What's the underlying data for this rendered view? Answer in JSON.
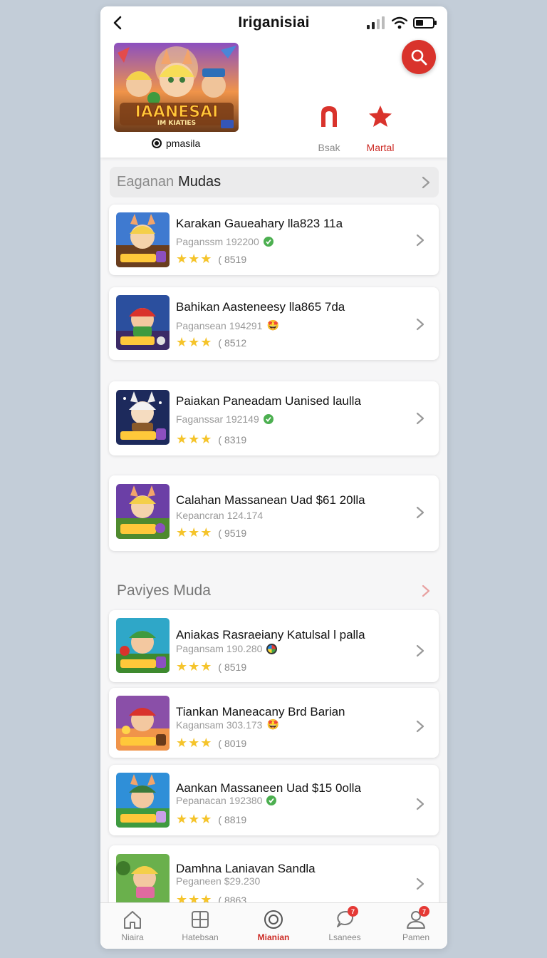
{
  "header": {
    "title": "Iriganisiai",
    "banner_text": "IAANESAI",
    "banner_subtext": "IM KIATIES",
    "brand_label": "pmasila",
    "actions": [
      {
        "label": "Bsak",
        "icon": "bookmark-icon"
      },
      {
        "label": "Martal",
        "icon": "star-icon"
      }
    ]
  },
  "sections": [
    {
      "title_muted": "Eaganan",
      "title_strong": "Mudas",
      "items": [
        {
          "title": "Karakan Gaueahary lla823 11a",
          "sub": "Paganssm 192200",
          "badge": "check",
          "rating_text": "( 8519",
          "stars": "★★★"
        },
        {
          "title": "Bahikan Aasteneesy lla865 7da",
          "sub": "Pagansean 194291",
          "badge": "emoji",
          "rating_text": "( 8512",
          "stars": "★★★"
        },
        {
          "title": "Paiakan Paneadam Uanised laulla",
          "sub": "Faganssar 192149",
          "badge": "check",
          "rating_text": "( 8319",
          "stars": "★★★"
        },
        {
          "title": "Calahan Massanean Uad $61 20lla",
          "sub": "Kepancran 124.174",
          "badge": "none",
          "rating_text": "( 9519",
          "stars": "★★★"
        }
      ]
    },
    {
      "title_muted": "Paviyes Muda",
      "title_strong": "",
      "items": [
        {
          "title": "Aniakas Rasraeiany Katulsal l palla",
          "sub": "Pagansam 190.280",
          "badge": "globe",
          "rating_text": "( 8519",
          "stars": "★★★"
        },
        {
          "title": "Tiankan Maneacany Brd Barian",
          "sub": "Kagansam 303.173",
          "badge": "emoji",
          "rating_text": "( 8019",
          "stars": "★★★"
        },
        {
          "title": "Aankan Massaneen Uad $15 0olla",
          "sub": "Pepanacan 192380",
          "badge": "check",
          "rating_text": "( 8819",
          "stars": "★★★"
        },
        {
          "title": "Damhna Laniavan Sandla",
          "sub": "Peganeen $29.230",
          "badge": "none",
          "rating_text": "( 8863",
          "stars": "★★★"
        }
      ]
    }
  ],
  "bottom_nav": [
    {
      "label": "Niaira",
      "icon": "home-icon",
      "active": false,
      "badge": ""
    },
    {
      "label": "Hatebsan",
      "icon": "grid-icon",
      "active": false,
      "badge": ""
    },
    {
      "label": "Mianian",
      "icon": "target-icon",
      "active": true,
      "badge": ""
    },
    {
      "label": "Lsanees",
      "icon": "chat-icon",
      "active": false,
      "badge": "7"
    },
    {
      "label": "Pamen",
      "icon": "profile-icon",
      "active": false,
      "badge": "7"
    }
  ],
  "colors": {
    "accent": "#d9332c",
    "star": "#f5c42b",
    "verified": "#4caf50",
    "background": "#c3cdd8"
  }
}
